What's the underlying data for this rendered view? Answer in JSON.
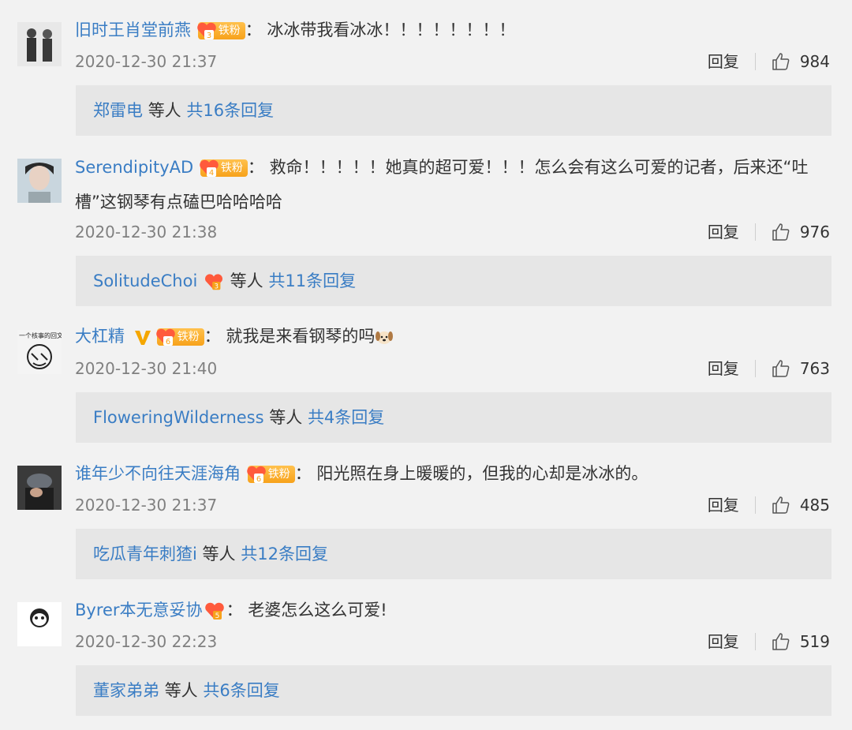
{
  "badge_label": "铁粉",
  "reply_label": "回复",
  "etc_label": "等人",
  "comments": [
    {
      "username": "旧时王肖堂前燕",
      "has_fan_badge": true,
      "level": "3",
      "text": "冰冰带我看冰冰！！！！！！！！",
      "text_line2": "",
      "time": "2020-12-30 21:37",
      "likes": "984",
      "reply_user": "郑雷电",
      "reply_count": "共16条回复"
    },
    {
      "username": "SerendipityAD",
      "has_fan_badge": true,
      "level": "4",
      "text": "救命！！！！！她真的超可爱！！！怎么会有这么可爱的记者，后来还“吐",
      "text_line2": "槽”这钢琴有点磕巴哈哈哈哈",
      "time": "2020-12-30 21:38",
      "likes": "976",
      "reply_user": "SolitudeChoi",
      "reply_count": "共11条回复"
    },
    {
      "username": "大杠精",
      "has_fan_badge": true,
      "level": "6",
      "text": "就我是来看钢琴的吗",
      "text_line2": "",
      "time": "2020-12-30 21:40",
      "likes": "763",
      "reply_user": "FloweringWilderness",
      "reply_count": "共4条回复"
    },
    {
      "username": "谁年少不向往天涯海角",
      "has_fan_badge": true,
      "level": "6",
      "text": "阳光照在身上暖暖的，但我的心却是冰冰的。",
      "text_line2": "",
      "time": "2020-12-30 21:37",
      "likes": "485",
      "reply_user": "吃瓜青年刺猹i",
      "reply_count": "共12条回复"
    },
    {
      "username": "Byrer本无意妥协",
      "has_fan_badge": false,
      "level": "5",
      "text": "老婆怎么这么可爱!",
      "text_line2": "",
      "time": "2020-12-30 22:23",
      "likes": "519",
      "reply_user": "董家弟弟",
      "reply_count": "共6条回复"
    }
  ],
  "colors": {
    "link": "#3a7dc4",
    "badge": "#f7a21b",
    "vip": "#f5a700"
  }
}
